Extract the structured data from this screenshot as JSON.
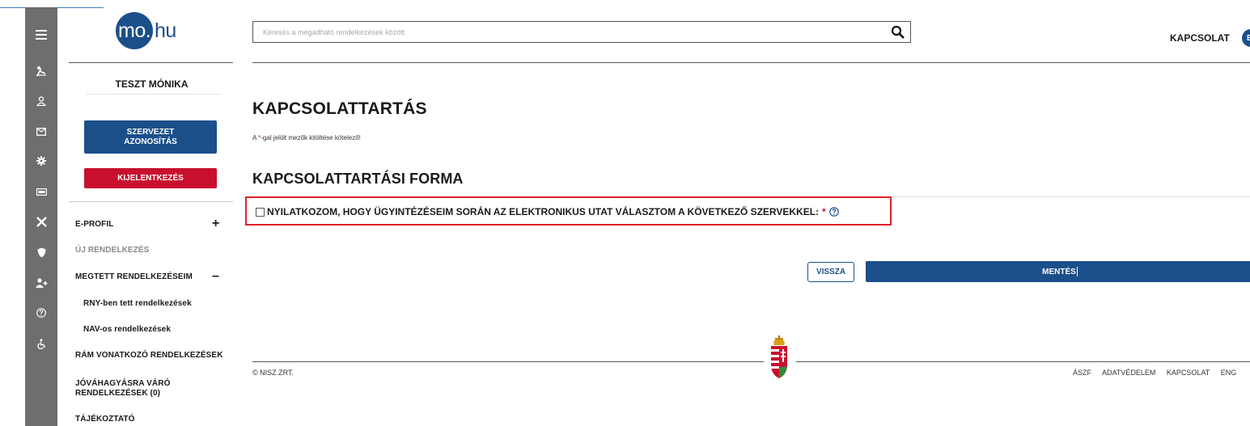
{
  "logo": {
    "circle_text": "mo.",
    "rest_text": "hu"
  },
  "sidebar": {
    "user_name": "TESZT MÓNIKA",
    "org_button": "SZERVEZET AZONOSÍTÁS",
    "logout_button": "KIJELENTKEZÉS",
    "nav": [
      {
        "label": "E-PROFIL",
        "toggle": "+"
      },
      {
        "label": "ÚJ RENDELKEZÉS"
      },
      {
        "label": "MEGTETT RENDELKEZÉSEIM",
        "toggle": "–"
      },
      {
        "label": "RNY-ben tett rendelkezések"
      },
      {
        "label": "NAV-os rendelkezések"
      },
      {
        "label": "RÁM VONATKOZÓ RENDELKEZÉSEK"
      },
      {
        "label": "JÓVÁHAGYÁSRA VÁRÓ RENDELKEZÉSEK (0)"
      },
      {
        "label": "TÁJÉKOZTATÓ"
      }
    ]
  },
  "rail_icons": [
    "menu-icon",
    "person-pointing-icon",
    "user-icon",
    "mail-icon",
    "gear-icon",
    "id-card-icon",
    "tools-icon",
    "shield-icon",
    "add-user-icon",
    "help-circle-icon",
    "accessibility-icon"
  ],
  "header": {
    "search_placeholder": "Keresés a megadható rendelkezések között",
    "kapcsolat": "KAPCSOLAT",
    "lang": "E"
  },
  "main": {
    "title": "KAPCSOLATTARTÁS",
    "required_prefix": "A ",
    "required_star": "*",
    "required_suffix": "-gal jelölt mezők kitöltése kötelező!",
    "section_title": "KAPCSOLATTARTÁSI FORMA",
    "declaration": "NYILATKOZOM, HOGY ÜGYINTÉZÉSEIM SORÁN AZ ELEKTRONIKUS UTAT VÁLASZTOM A KÖVETKEZŐ SZERVEKKEL:",
    "declaration_star": "*",
    "declaration_checked": false,
    "back_button": "VISSZA",
    "save_button": "MENTÉS"
  },
  "footer": {
    "copyright": "© NISZ ZRT.",
    "links": [
      "ÁSZF",
      "ADATVÉDELEM",
      "KAPCSOLAT",
      "ENG"
    ]
  },
  "colors": {
    "brand_blue": "#1b4f8a",
    "logout_red": "#c8102e",
    "highlight_red": "#e0202a",
    "rail_gray": "#6e6e6e"
  }
}
